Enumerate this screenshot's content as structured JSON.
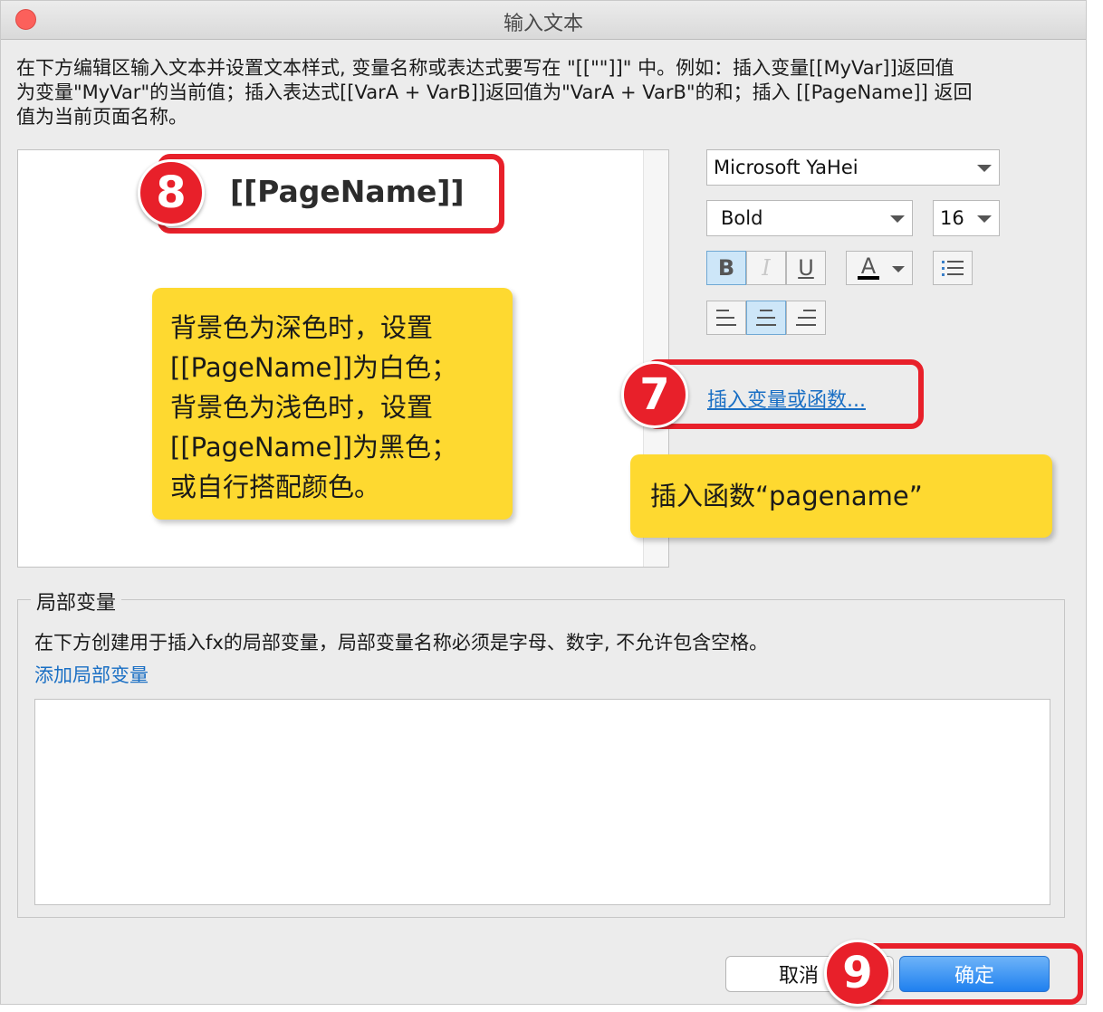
{
  "window": {
    "title": "输入文本"
  },
  "description": {
    "line1": "在下方编辑区输入文本并设置文本样式, 变量名称或表达式要写在 \"[[\"\"]]\" 中。例如：插入变量[[MyVar]]返回值",
    "line2": "为变量\"MyVar\"的当前值；插入表达式[[VarA + VarB]]返回值为\"VarA + VarB\"的和；插入 [[PageName]] 返回",
    "line3": "值为当前页面名称。"
  },
  "editor": {
    "content": "[[PageName]]"
  },
  "toolbar": {
    "font_family": "Microsoft YaHei",
    "font_weight": "Bold",
    "font_size": "16",
    "bold_label": "B",
    "italic_label": "I",
    "underline_label": "U",
    "color_label": "A",
    "text_color": "#000000",
    "insert_link": "插入变量或函数..."
  },
  "local_vars": {
    "legend": "局部变量",
    "description": "在下方创建用于插入fx的局部变量，局部变量名称必须是字母、数字, 不允许包含空格。",
    "add_link": "添加局部变量"
  },
  "buttons": {
    "cancel": "取消",
    "ok": "确定"
  },
  "annotations": {
    "badge7": "7",
    "badge8": "8",
    "badge9": "9",
    "tip8": [
      "背景色为深色时，设置",
      "[[PageName]]为白色；",
      "背景色为浅色时，设置",
      "[[PageName]]为黑色；",
      "或自行搭配颜色。"
    ],
    "tip7": "插入函数“pagename”"
  },
  "colors": {
    "annotation_red": "#e8202a",
    "bubble_yellow": "#fed930",
    "link_blue": "#1a6fc4",
    "primary_button": "#1f80ef"
  }
}
